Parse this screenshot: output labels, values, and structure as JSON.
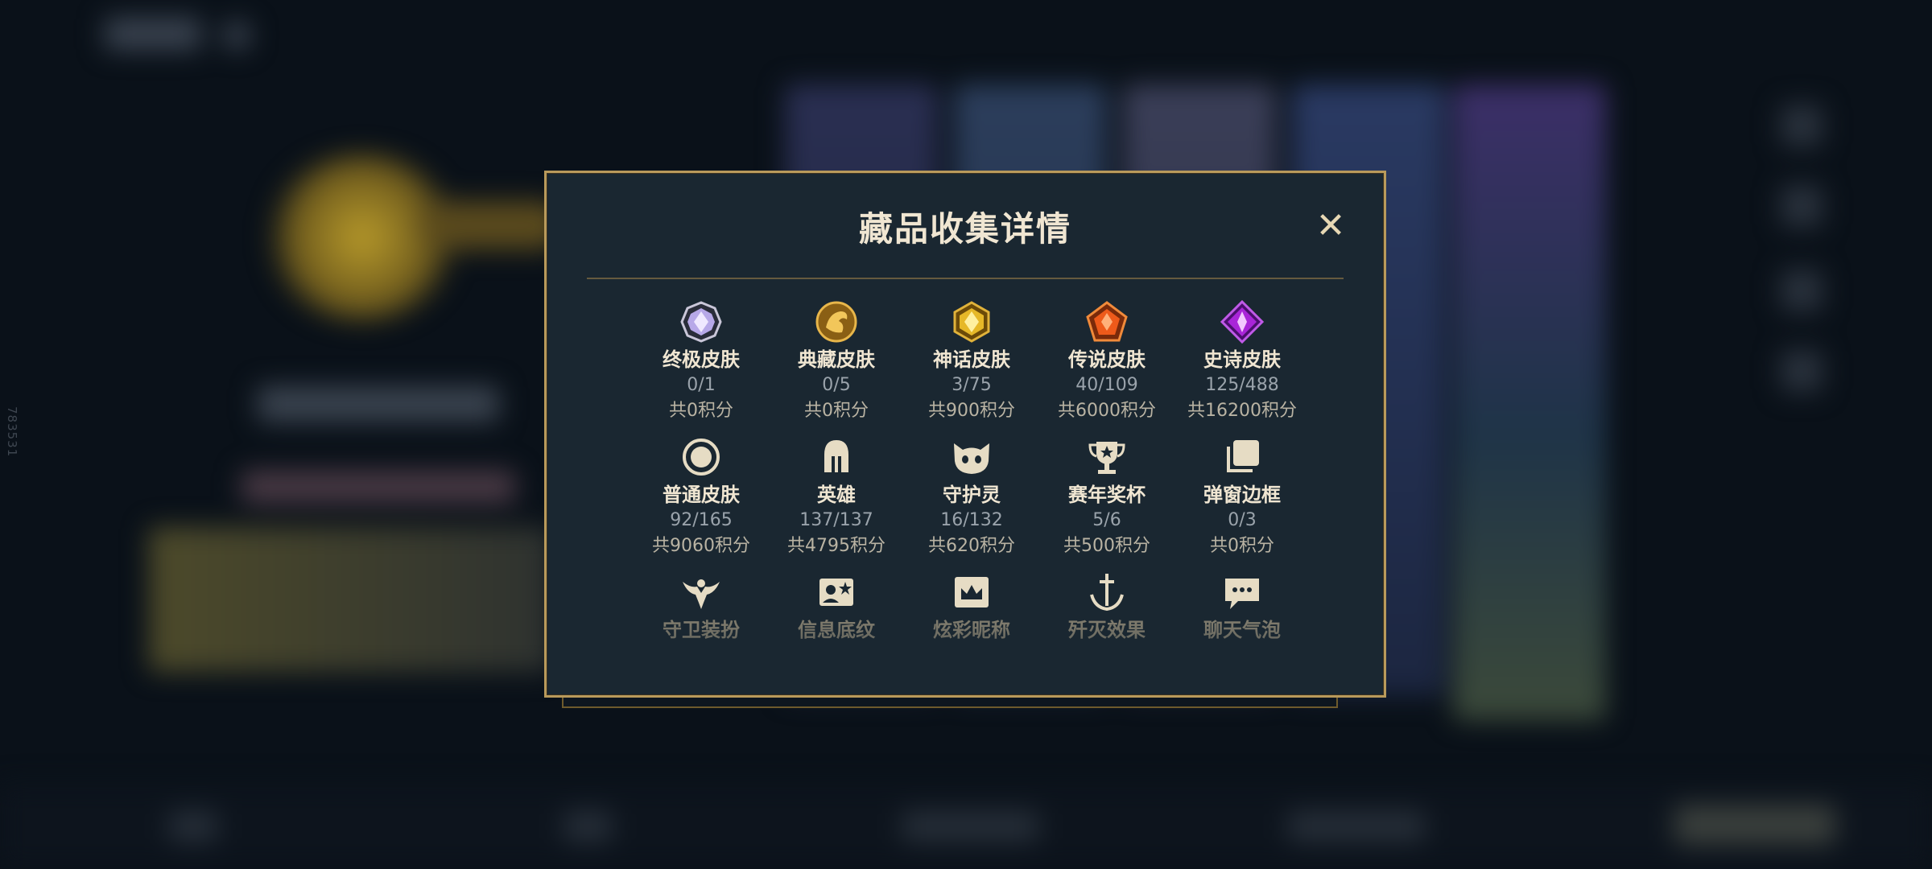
{
  "background": {
    "side_note": "783531"
  },
  "dialog": {
    "title": "藏品收集详情",
    "close_symbol": "✕",
    "items": [
      {
        "label": "终极皮肤",
        "count": "0/1",
        "points": "共0积分",
        "icon": "ultimate-gem-icon"
      },
      {
        "label": "典藏皮肤",
        "count": "0/5",
        "points": "共0积分",
        "icon": "dragon-coin-icon"
      },
      {
        "label": "神话皮肤",
        "count": "3/75",
        "points": "共900积分",
        "icon": "gold-hexagon-gem-icon"
      },
      {
        "label": "传说皮肤",
        "count": "40/109",
        "points": "共6000积分",
        "icon": "orange-pentagon-gem-icon"
      },
      {
        "label": "史诗皮肤",
        "count": "125/488",
        "points": "共16200积分",
        "icon": "purple-diamond-gem-icon"
      },
      {
        "label": "普通皮肤",
        "count": "92/165",
        "points": "共9060积分",
        "icon": "ring-icon"
      },
      {
        "label": "英雄",
        "count": "137/137",
        "points": "共4795积分",
        "icon": "helmet-icon"
      },
      {
        "label": "守护灵",
        "count": "16/132",
        "points": "共620积分",
        "icon": "guardian-face-icon"
      },
      {
        "label": "赛年奖杯",
        "count": "5/6",
        "points": "共500积分",
        "icon": "trophy-icon"
      },
      {
        "label": "弹窗边框",
        "count": "0/3",
        "points": "共0积分",
        "icon": "stacked-frames-icon"
      },
      {
        "label": "守卫装扮",
        "icon": "ward-icon"
      },
      {
        "label": "信息底纹",
        "icon": "info-card-icon"
      },
      {
        "label": "炫彩昵称",
        "icon": "crown-card-icon"
      },
      {
        "label": "歼灭效果",
        "icon": "sword-anchor-icon"
      },
      {
        "label": "聊天气泡",
        "icon": "chat-bubble-icon"
      }
    ]
  },
  "colors": {
    "accent_gold": "#b99a5b",
    "panel_bg": "#1a2731",
    "title_text": "#f0e6d2"
  }
}
